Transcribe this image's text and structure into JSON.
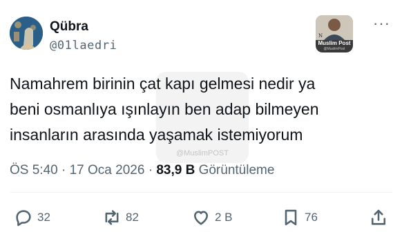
{
  "author": {
    "name": "Qübra",
    "handle": "@01laedri"
  },
  "badge": {
    "title": "Muslim Post",
    "subtitle": "@MuslimPost"
  },
  "watermark_text": "@MuslimPOST",
  "tweet": {
    "line1": "Namahrem birinin çat kapı gelmesi nedir ya",
    "line2": "beni osmanlıya ışınlayın ben adap bilmeyen",
    "line3": "insanların arasında yaşamak istemiyorum"
  },
  "meta": {
    "time": "ÖS 5:40",
    "date": "17 Oca 2026",
    "views": "83,9 B",
    "views_label": "Görüntüleme"
  },
  "actions": {
    "replies": "32",
    "reposts": "82",
    "likes": "2 B",
    "bookmarks": "76"
  },
  "icons": [
    "more-icon",
    "reply-icon",
    "repost-icon",
    "like-icon",
    "bookmark-icon",
    "share-icon"
  ],
  "colors": {
    "text": "#0f1419",
    "secondary": "#536471",
    "divider": "#eff3f4"
  }
}
